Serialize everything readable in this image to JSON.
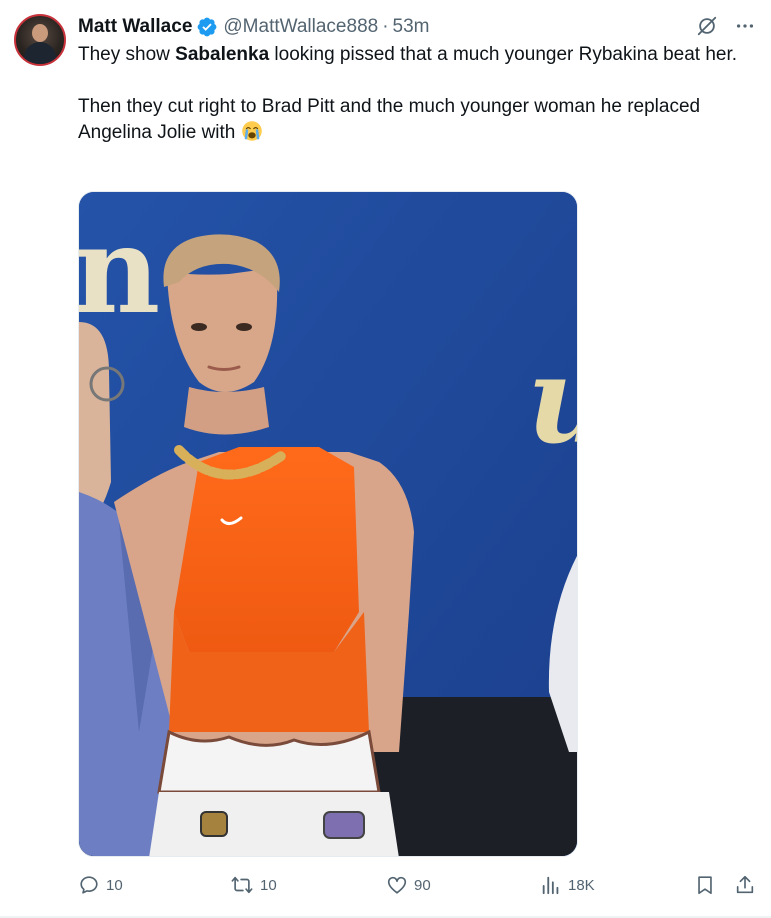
{
  "author": {
    "display_name": "Matt Wallace",
    "handle": "@MattWallace888",
    "separator": "·",
    "time": "53m",
    "verified": true,
    "verified_color": "#1d9bf0"
  },
  "tweet": {
    "p1_before": "They show ",
    "p1_bold": "Sabalenka",
    "p1_after": " looking pissed that a much younger Rybakina beat her.",
    "p2": "Then they cut right to Brad Pitt and the much younger woman he replaced Angelina Jolie with",
    "emoji": "loudly-crying-face"
  },
  "media": {
    "type": "photo",
    "subject": "tennis player in orange top, gold chain necklace, blue backdrop"
  },
  "actions": {
    "reply_count": "10",
    "repost_count": "10",
    "like_count": "90",
    "views_count": "18K"
  },
  "icons": {
    "top": [
      "grok-icon",
      "more-icon"
    ],
    "bar": [
      "reply-icon",
      "repost-icon",
      "like-icon",
      "views-icon",
      "bookmark-icon",
      "share-icon"
    ]
  },
  "colors": {
    "text": "#0f1419",
    "secondary": "#536471",
    "accent": "#1d9bf0"
  }
}
